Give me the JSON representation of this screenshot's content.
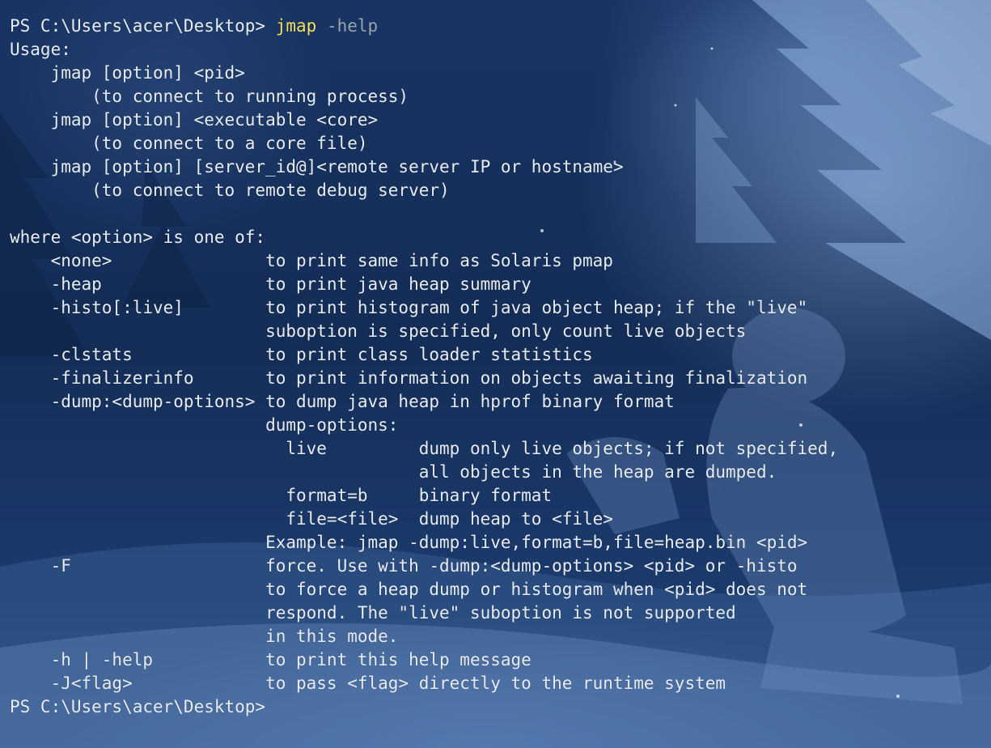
{
  "window": {
    "prompt": "PS C:\\Users\\acer\\Desktop> ",
    "command": "jmap",
    "command_arg": " -help"
  },
  "output_lines": [
    "Usage:",
    "    jmap [option] <pid>",
    "        (to connect to running process)",
    "    jmap [option] <executable <core>",
    "        (to connect to a core file)",
    "    jmap [option] [server_id@]<remote server IP or hostname>",
    "        (to connect to remote debug server)",
    "",
    "where <option> is one of:",
    "    <none>               to print same info as Solaris pmap",
    "    -heap                to print java heap summary",
    "    -histo[:live]        to print histogram of java object heap; if the \"live\"",
    "                         suboption is specified, only count live objects",
    "    -clstats             to print class loader statistics",
    "    -finalizerinfo       to print information on objects awaiting finalization",
    "    -dump:<dump-options> to dump java heap in hprof binary format",
    "                         dump-options:",
    "                           live         dump only live objects; if not specified,",
    "                                        all objects in the heap are dumped.",
    "                           format=b     binary format",
    "                           file=<file>  dump heap to <file>",
    "                         Example: jmap -dump:live,format=b,file=heap.bin <pid>",
    "    -F                   force. Use with -dump:<dump-options> <pid> or -histo",
    "                         to force a heap dump or histogram when <pid> does not",
    "                         respond. The \"live\" suboption is not supported",
    "                         in this mode.",
    "    -h | -help           to print this help message",
    "    -J<flag>             to pass <flag> directly to the runtime system"
  ],
  "final_prompt": "PS C:\\Users\\acer\\Desktop>",
  "colors": {
    "text": "#e9edf2",
    "command": "#f1e05a",
    "argument": "#9aa6b4",
    "background": "#142d57"
  }
}
